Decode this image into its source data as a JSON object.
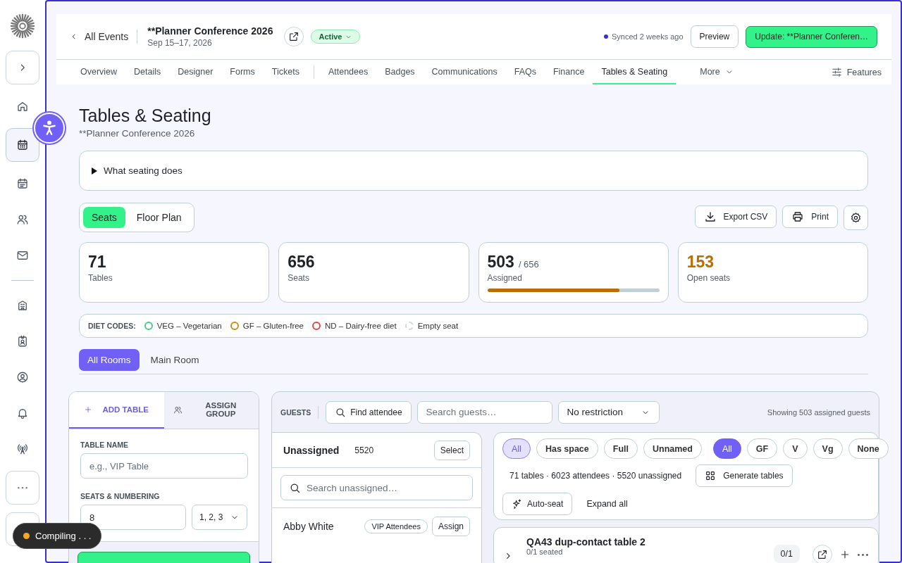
{
  "sidebar": {
    "items": [
      {
        "kind": "expand",
        "selected": false
      },
      {
        "kind": "home",
        "selected": false
      },
      {
        "kind": "calendar",
        "selected": true
      },
      {
        "kind": "schedule",
        "selected": false
      },
      {
        "kind": "people",
        "selected": false
      },
      {
        "kind": "mail",
        "selected": false
      },
      {
        "kind": "building",
        "selected": false
      },
      {
        "kind": "badge",
        "selected": false
      },
      {
        "kind": "user",
        "selected": false
      },
      {
        "kind": "bell",
        "selected": false
      },
      {
        "kind": "broadcast",
        "selected": false
      },
      {
        "kind": "more",
        "selected": false
      },
      {
        "kind": "blank",
        "selected": false
      }
    ]
  },
  "header": {
    "back_label": "All Events",
    "event_title": "**Planner Conference 2026",
    "dates": "Sep 15–17, 2026",
    "status": "Active",
    "sync_status": "Synced 2 weeks ago",
    "preview_button": "Preview",
    "update_button": "Update: **Planner Conferen…"
  },
  "nav_tab_groups": [
    [
      {
        "label": "Overview",
        "selected": false
      },
      {
        "label": "Details",
        "selected": false
      },
      {
        "label": "Designer",
        "selected": false
      },
      {
        "label": "Forms",
        "selected": false
      },
      {
        "label": "Tickets",
        "selected": false
      }
    ],
    [
      {
        "label": "Attendees",
        "selected": false
      },
      {
        "label": "Badges",
        "selected": false
      },
      {
        "label": "Communications",
        "selected": false
      },
      {
        "label": "FAQs",
        "selected": false
      },
      {
        "label": "Finance",
        "selected": false
      },
      {
        "label": "Tables & Seating",
        "selected": true
      }
    ]
  ],
  "nav_more": "More",
  "nav_features": "Features",
  "page": {
    "title": "Tables & Seating",
    "subtitle": "**Planner Conference 2026"
  },
  "disclosure": {
    "label": "What seating does",
    "expanded": false
  },
  "view_toggle": [
    {
      "label": "Seats",
      "selected": true
    },
    {
      "label": "Floor Plan",
      "selected": false
    }
  ],
  "actions": [
    {
      "kind": "export",
      "label": "Export CSV"
    },
    {
      "kind": "print",
      "label": "Print"
    },
    {
      "kind": "settings"
    }
  ],
  "stats": [
    {
      "value": "71",
      "label": "Tables",
      "color": "#1f2328"
    },
    {
      "value": "656",
      "label": "Seats",
      "color": "#1f2328"
    },
    {
      "value": "503",
      "total": "/ 656",
      "label": "Assigned",
      "color": "#1f2328",
      "level": 0.767
    },
    {
      "value": "153",
      "label": "Open seats",
      "color": "#b86e00"
    }
  ],
  "diet_codes": {
    "title": "DIET CODES:",
    "items": [
      {
        "kind": "diet",
        "label": "VEG – Vegetarian",
        "color": "#4cc987"
      },
      {
        "kind": "diet",
        "label": "GF – Gluten-free",
        "color": "#d18b16"
      },
      {
        "kind": "diet",
        "label": "ND – Dairy-free diet",
        "color": "#e04848"
      },
      {
        "kind": "empty",
        "label": "Empty seat",
        "color": "#cfd8dc"
      }
    ]
  },
  "rooms": [
    {
      "label": "All Rooms",
      "selected": true
    },
    {
      "label": "Main Room",
      "selected": false
    }
  ],
  "add_panel": {
    "tabs": [
      {
        "kind": "add",
        "label": "ADD TABLE",
        "selected": true
      },
      {
        "kind": "group",
        "label": "ASSIGN GROUP",
        "selected": false
      }
    ],
    "name_label": "TABLE NAME",
    "name_placeholder": "e.g., VIP Table",
    "seats_label": "SEATS & NUMBERING",
    "seats_value": "8",
    "numbering": "1, 2, 3"
  },
  "guests": {
    "label": "GUESTS",
    "find_button": "Find attendee",
    "search_placeholder": "Search guests…",
    "restriction": "No restriction",
    "summary": "Showing 503 assigned guests"
  },
  "unassigned": {
    "title": "Unassigned",
    "count": "5520",
    "select_button": "Select",
    "search_placeholder": "Search unassigned…",
    "guests": [
      {
        "name": "Abby White",
        "tag": "VIP Attendees",
        "action": "Assign"
      }
    ]
  },
  "tables": {
    "status_filters": [
      {
        "label": "All",
        "selected": true
      },
      {
        "label": "Has space",
        "selected": false
      },
      {
        "label": "Full",
        "selected": false
      },
      {
        "label": "Unnamed",
        "selected": false
      }
    ],
    "diet_filters": [
      {
        "label": "All",
        "selected": true
      },
      {
        "label": "GF",
        "selected": false
      },
      {
        "label": "V",
        "selected": false
      },
      {
        "label": "Vg",
        "selected": false
      },
      {
        "label": "None",
        "selected": false
      }
    ],
    "summary": "71 tables · 6023 attendees · 5520 unassigned",
    "generate_button": "Generate tables",
    "autoseat_button": "Auto-seat",
    "expand_all": "Expand all",
    "items": [
      {
        "name": "QA43 dup-contact table 2",
        "seated": "0/1 seated",
        "count": "0/1",
        "expanded": false
      }
    ]
  },
  "toast": {
    "label": "Compiling . . .",
    "color": "#f5a623"
  }
}
